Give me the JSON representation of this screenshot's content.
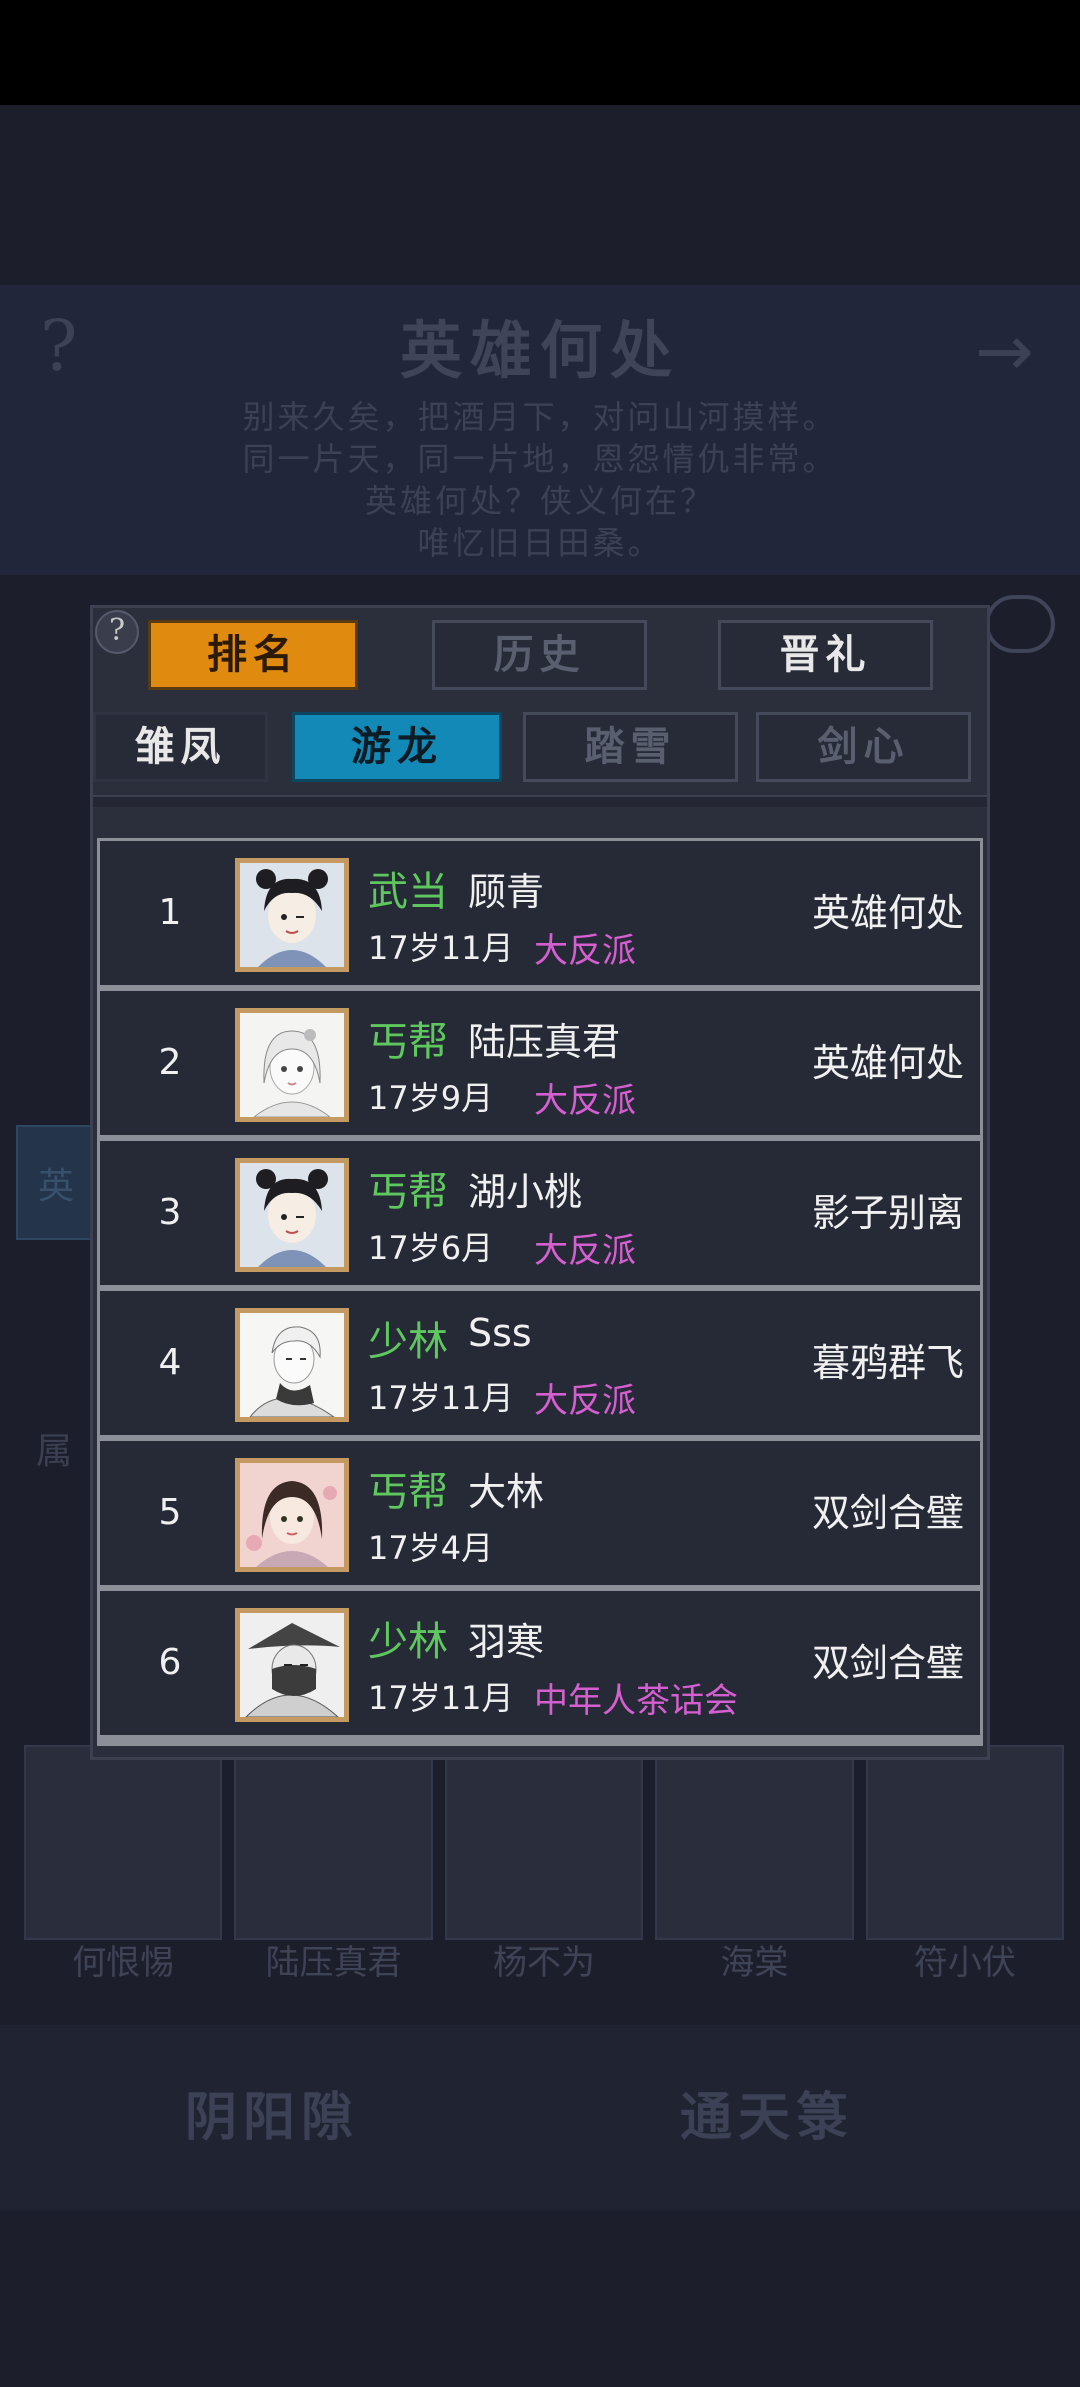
{
  "background": {
    "help_glyph": "?",
    "arrow_glyph": "→",
    "title": "英雄何处",
    "poem": [
      "别来久矣，把酒月下，对问山河摸样。",
      "同一片天，同一片地，恩怨情仇非常。",
      "英雄何处？侠义何在？",
      "唯忆旧日田桑。"
    ],
    "side_tab_label": "英",
    "attr_label": "属",
    "portrait_names": [
      "何恨惕",
      "陆压真君",
      "杨不为",
      "海棠",
      "符小伏"
    ],
    "bottom_buttons": [
      "阴阳隙",
      "通天箓"
    ]
  },
  "panel": {
    "help_glyph": "?",
    "top_tabs": [
      {
        "label": "排名",
        "active": true
      },
      {
        "label": "历史",
        "active": false
      },
      {
        "label": "晋礼",
        "active": false
      }
    ],
    "sub_tabs": [
      {
        "label": "雏凤",
        "active": false
      },
      {
        "label": "游龙",
        "active": true
      },
      {
        "label": "踏雪",
        "active": false
      },
      {
        "label": "剑心",
        "active": false
      }
    ],
    "rows": [
      {
        "rank": "1",
        "sect": "武当",
        "name": "顾青",
        "age": "17岁11月",
        "guild": "大反派",
        "title": "英雄何处"
      },
      {
        "rank": "2",
        "sect": "丐帮",
        "name": "陆压真君",
        "age": "17岁9月",
        "guild": "大反派",
        "title": "英雄何处"
      },
      {
        "rank": "3",
        "sect": "丐帮",
        "name": "湖小桃",
        "age": "17岁6月",
        "guild": "大反派",
        "title": "影子别离"
      },
      {
        "rank": "4",
        "sect": "少林",
        "name": "Sss",
        "age": "17岁11月",
        "guild": "大反派",
        "title": "暮鸦群飞"
      },
      {
        "rank": "5",
        "sect": "丐帮",
        "name": "大林",
        "age": "17岁4月",
        "guild": "",
        "title": "双剑合璧"
      },
      {
        "rank": "6",
        "sect": "少林",
        "name": "羽寒",
        "age": "17岁11月",
        "guild": "中年人茶话会",
        "title": "双剑合璧"
      }
    ]
  },
  "colors": {
    "sect": "#5ec85e",
    "guild": "#d55fd0",
    "tab_orange": "#e08a10",
    "tab_blue": "#1389b8"
  }
}
